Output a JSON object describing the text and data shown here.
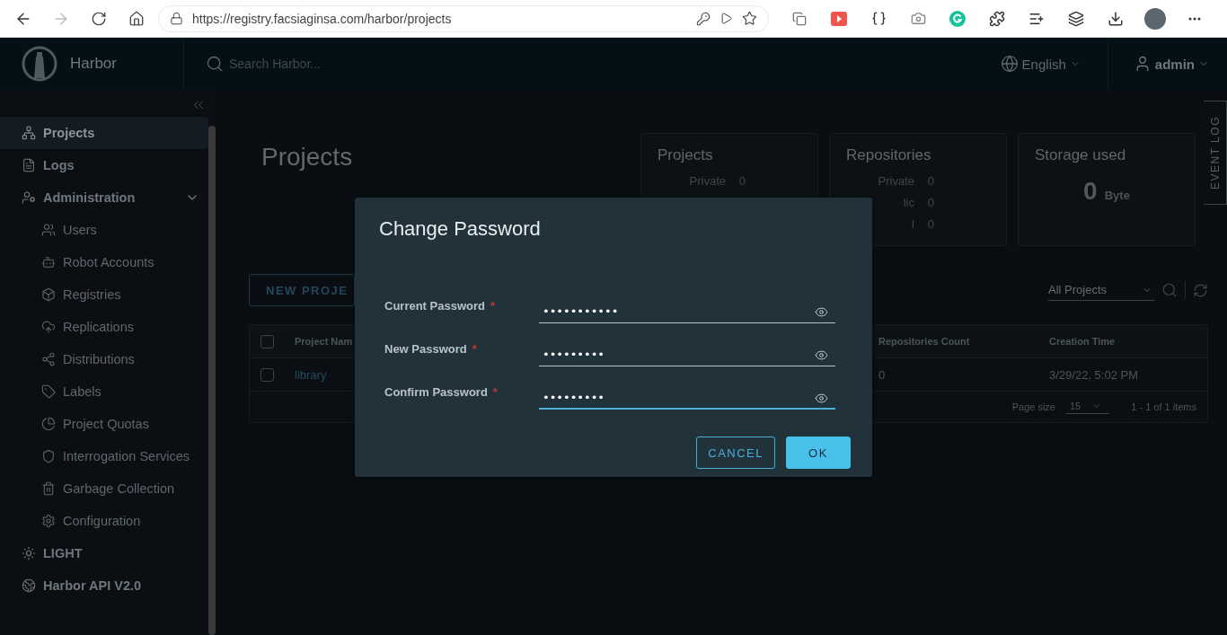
{
  "browser": {
    "url": "https://registry.facsiaginsa.com/harbor/projects"
  },
  "header": {
    "app_name": "Harbor",
    "search_placeholder": "Search Harbor...",
    "language": "English",
    "user": "admin"
  },
  "sidebar": {
    "items": [
      {
        "label": "Projects",
        "kind": "main",
        "selected": true
      },
      {
        "label": "Logs",
        "kind": "main",
        "selected": false
      },
      {
        "label": "Administration",
        "kind": "group",
        "selected": false,
        "expanded": true,
        "children": [
          {
            "label": "Users",
            "selected": false
          },
          {
            "label": "Robot Accounts",
            "selected": false
          },
          {
            "label": "Registries",
            "selected": false
          },
          {
            "label": "Replications",
            "selected": false
          },
          {
            "label": "Distributions",
            "selected": false
          },
          {
            "label": "Labels",
            "selected": false
          },
          {
            "label": "Project Quotas",
            "selected": false
          },
          {
            "label": "Interrogation Services",
            "selected": false
          },
          {
            "label": "Garbage Collection",
            "selected": false
          },
          {
            "label": "Configuration",
            "selected": false
          }
        ]
      },
      {
        "label": "LIGHT",
        "kind": "main",
        "selected": false
      },
      {
        "label": "Harbor API V2.0",
        "kind": "main",
        "selected": false
      }
    ]
  },
  "page": {
    "title": "Projects"
  },
  "cards": [
    {
      "kind": "counts",
      "title": "Projects",
      "rows": [
        {
          "label": "Private",
          "value": "0"
        }
      ]
    },
    {
      "kind": "counts",
      "title": "Repositories",
      "rows": [
        {
          "label": "Private",
          "value": "0"
        },
        {
          "label": "lic",
          "value": "0"
        },
        {
          "label": "l",
          "value": "0"
        }
      ]
    },
    {
      "kind": "storage",
      "title": "Storage used",
      "total": "0",
      "unit": "Byte"
    }
  ],
  "toolbar": {
    "new_button": "NEW PROJE",
    "filter": "All Projects"
  },
  "table": {
    "header_checked": false,
    "columns": [
      "Project Nam",
      "Repositories Count",
      "Creation Time"
    ],
    "rows": [
      {
        "checked": false,
        "cells": [
          "library",
          "0",
          "3/29/22, 5:02 PM"
        ]
      }
    ],
    "footer": {
      "page_size_label": "Page size",
      "page_size": "15",
      "range": "1 - 1 of 1 items"
    }
  },
  "event_log": "EVENT LOG",
  "dialog": {
    "title": "Change Password",
    "fields": [
      {
        "label": "Current Password",
        "required_mark": "*",
        "value": "•••••••••••",
        "focused": false
      },
      {
        "label": "New Password",
        "required_mark": "*",
        "value": "•••••••••",
        "focused": false
      },
      {
        "label": "Confirm Password",
        "required_mark": "*",
        "value": "•••••••••",
        "focused": true
      }
    ],
    "buttons": [
      {
        "label": "CANCEL",
        "kind": "secondary"
      },
      {
        "label": "OK",
        "kind": "primary"
      }
    ]
  }
}
